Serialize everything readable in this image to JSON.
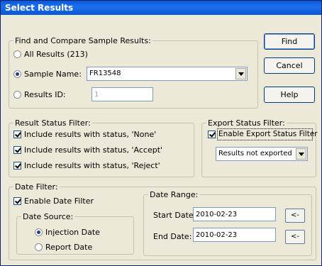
{
  "window": {
    "title": "Select Results"
  },
  "find_group": {
    "legend": "Find and Compare Sample Results:",
    "all_results_label": "All Results (213)",
    "sample_name_label": "Sample Name:",
    "sample_name_value": "FR13548",
    "results_id_label": "Results ID:",
    "results_id_value": "1",
    "selected": "sample_name"
  },
  "buttons": {
    "find_label": "Find",
    "cancel_label": "Cancel",
    "help_label": "Help"
  },
  "result_status_filter": {
    "legend": "Result Status Filter:",
    "items": [
      {
        "label": "Include results with status, 'None'",
        "checked": true
      },
      {
        "label": "Include results with status, 'Accept'",
        "checked": true
      },
      {
        "label": "Include results with status, 'Reject'",
        "checked": true
      }
    ]
  },
  "export_status_filter": {
    "legend": "Export Status Filter:",
    "enable_label": "Enable Export Status Filter",
    "enable_checked": true,
    "dropdown_value": "Results not exported"
  },
  "date_filter": {
    "legend": "Date Filter:",
    "enable_label": "Enable Date Filter",
    "enable_checked": true,
    "date_source": {
      "legend": "Date Source:",
      "injection_label": "Injection Date",
      "report_label": "Report Date",
      "selected": "injection"
    },
    "date_range": {
      "legend": "Date Range:",
      "start_label": "Start Date:",
      "start_value": "2010-02-23",
      "end_label": "End Date:",
      "end_value": "2010-02-23",
      "picker_label": "<-"
    }
  }
}
